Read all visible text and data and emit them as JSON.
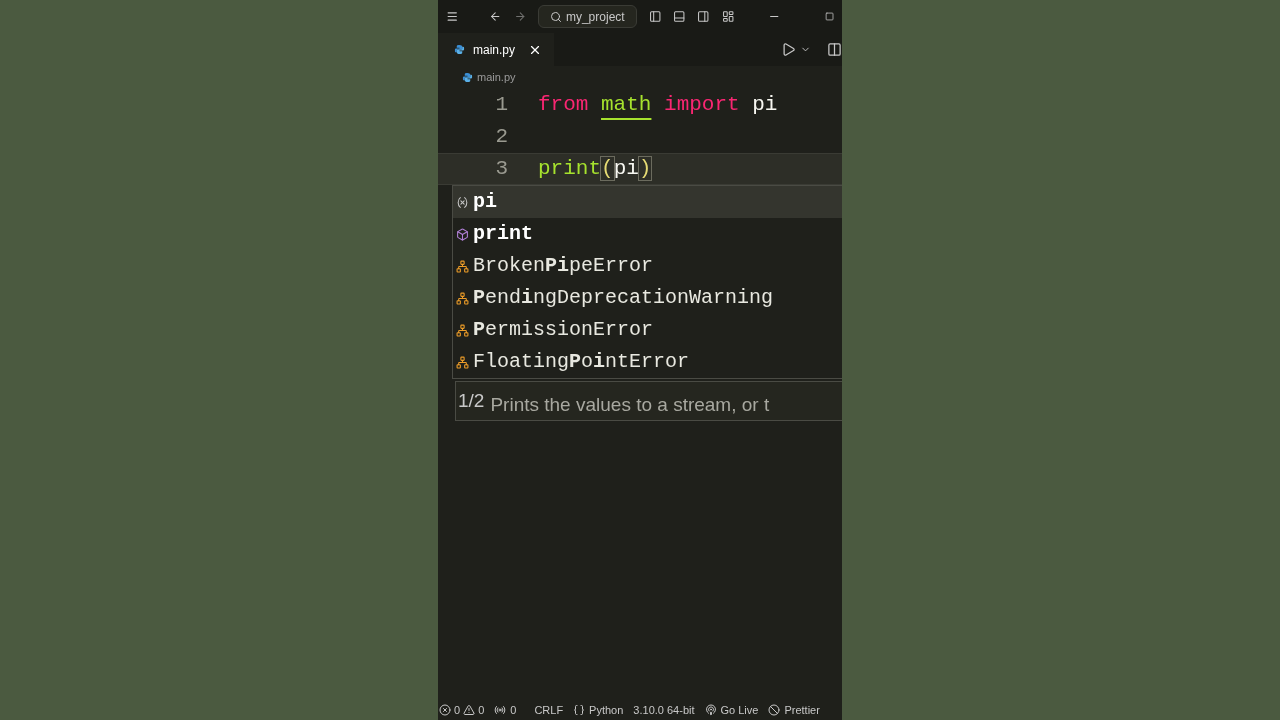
{
  "title_bar": {
    "search": "my_project"
  },
  "tabs": [
    {
      "label": "main.py",
      "selected": true
    }
  ],
  "breadcrumb": "main.py",
  "code": [
    {
      "number": "1",
      "current": false,
      "tokens": [
        {
          "text": "from ",
          "kind": "keyword"
        },
        {
          "text": "math",
          "kind": "module"
        },
        {
          "text": " import ",
          "kind": "keyword"
        },
        {
          "text": "pi",
          "kind": "plain"
        }
      ]
    },
    {
      "number": "2",
      "current": false
    },
    {
      "number": "3",
      "current": true,
      "tokens": [
        {
          "text": "print",
          "kind": "function"
        },
        {
          "text": "(",
          "kind": "bracket"
        },
        {
          "text": "pi",
          "kind": "plain"
        },
        {
          "text": ")",
          "kind": "bracket"
        }
      ]
    }
  ],
  "suggestions": [
    {
      "label": "pi",
      "kind": "variable",
      "selected": true
    },
    {
      "label": "print",
      "kind": "function",
      "selected": false
    },
    {
      "label": "Broken**Pi**peError",
      "kind": "class",
      "selected": false
    },
    {
      "label": "**P**end**i**ngDeprecationWarning",
      "kind": "class",
      "selected": false
    },
    {
      "label": "**P**ermissionError",
      "kind": "class",
      "selected": false
    },
    {
      "label": "Floating**P**o**i**ntError",
      "kind": "class",
      "selected": false
    }
  ],
  "signature": {
    "counter": "1/2",
    "text": "Prints the values to a stream, or t"
  },
  "status_bar": {
    "errors": "0",
    "warnings": "0",
    "ports": "0",
    "eol": "CRLF",
    "language": "Python",
    "interpreter": "3.10.0 64-bit",
    "live": "Go Live",
    "formatter": "Prettier"
  }
}
